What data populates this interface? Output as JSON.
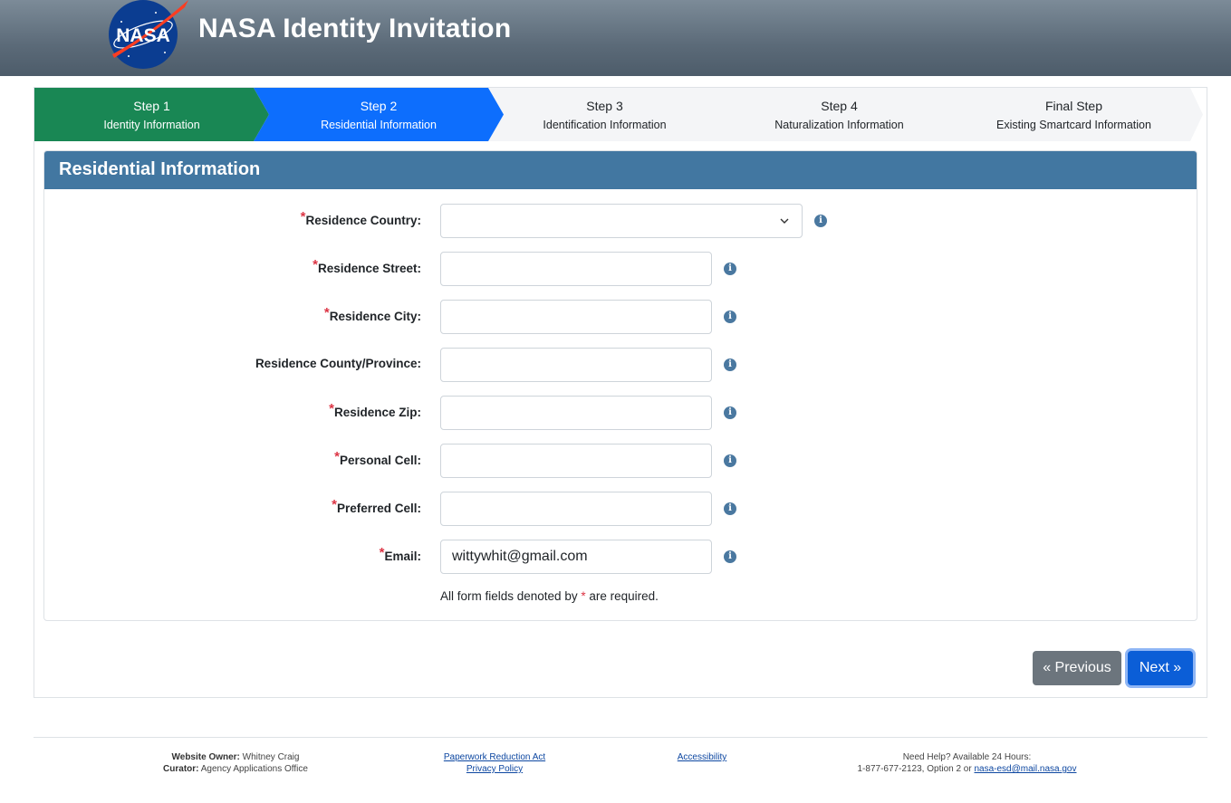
{
  "header": {
    "title": "NASA Identity Invitation",
    "logo_text": "NASA"
  },
  "steps": [
    {
      "title": "Step 1",
      "subtitle": "Identity Information",
      "state": "completed"
    },
    {
      "title": "Step 2",
      "subtitle": "Residential Information",
      "state": "active"
    },
    {
      "title": "Step 3",
      "subtitle": "Identification Information",
      "state": "pending"
    },
    {
      "title": "Step 4",
      "subtitle": "Naturalization Information",
      "state": "pending"
    },
    {
      "title": "Final Step",
      "subtitle": "Existing Smartcard Information",
      "state": "pending"
    }
  ],
  "form": {
    "heading": "Residential Information",
    "fields": [
      {
        "label": "Residence Country:",
        "required": true,
        "type": "select",
        "value": ""
      },
      {
        "label": "Residence Street:",
        "required": true,
        "type": "text",
        "value": ""
      },
      {
        "label": "Residence City:",
        "required": true,
        "type": "text",
        "value": ""
      },
      {
        "label": "Residence County/Province:",
        "required": false,
        "type": "text",
        "value": ""
      },
      {
        "label": "Residence Zip:",
        "required": true,
        "type": "text",
        "value": ""
      },
      {
        "label": "Personal Cell:",
        "required": true,
        "type": "text",
        "value": ""
      },
      {
        "label": "Preferred Cell:",
        "required": true,
        "type": "text",
        "value": ""
      },
      {
        "label": "Email:",
        "required": true,
        "type": "text",
        "value": "wittywhit@gmail.com"
      }
    ],
    "required_note_before": "All form fields denoted by",
    "required_star": "*",
    "required_note_after": "are required.",
    "info_glyph": "i"
  },
  "nav": {
    "previous_label": "« Previous",
    "next_label": "Next »"
  },
  "footer": {
    "owner_label": "Website Owner:",
    "owner_value": "Whitney Craig",
    "curator_label": "Curator:",
    "curator_value": "Agency Applications Office",
    "paperwork_link": "Paperwork Reduction Act",
    "privacy_link": "Privacy Policy",
    "accessibility_link": "Accessibility",
    "help_text": "Need Help? Available 24 Hours:",
    "phone_text": "1-877-677-2123, Option 2 or",
    "email_link": "nasa-esd@mail.nasa.gov"
  },
  "colors": {
    "header_bg": "#5b6a78",
    "step_completed": "#198754",
    "step_active": "#0d6efd",
    "card_header": "#4277a1",
    "required": "#dc3545",
    "btn_previous": "#6c757d",
    "btn_next": "#0b5ed7"
  }
}
